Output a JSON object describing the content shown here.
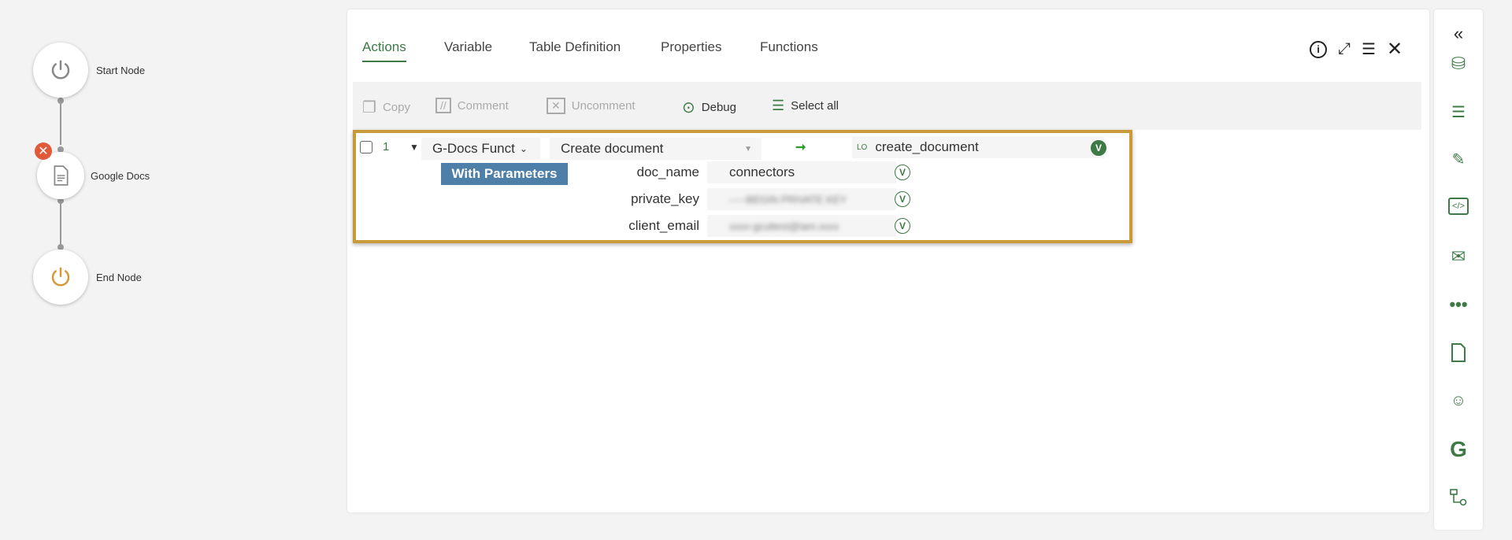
{
  "flow": {
    "nodes": [
      {
        "label": "Start Node",
        "icon": "power-icon"
      },
      {
        "label": "Google Docs",
        "icon": "document-icon"
      },
      {
        "label": "End Node",
        "icon": "power-icon"
      }
    ]
  },
  "tabs": [
    {
      "label": "Actions",
      "active": true
    },
    {
      "label": "Variable"
    },
    {
      "label": "Table Definition"
    },
    {
      "label": "Properties"
    },
    {
      "label": "Functions"
    }
  ],
  "toolbar": {
    "copy": "Copy",
    "comment": "Comment",
    "uncomment": "Uncomment",
    "debug": "Debug",
    "select_all": "Select all"
  },
  "row": {
    "number": "1",
    "category": "G-Docs Funct",
    "action": "Create document",
    "output_prefix": "LO",
    "output": "create_document",
    "params_button": "With Parameters",
    "params": [
      {
        "name": "doc_name",
        "value": "connectors"
      },
      {
        "name": "private_key",
        "value": "-----BEGIN PRIVATE KEY"
      },
      {
        "name": "client_email",
        "value": "xxxx-gcuttest@iam.xxxx"
      }
    ]
  },
  "colors": {
    "accent": "#3d7a46",
    "highlight": "#c99a3a",
    "button": "#4e7fa8"
  }
}
